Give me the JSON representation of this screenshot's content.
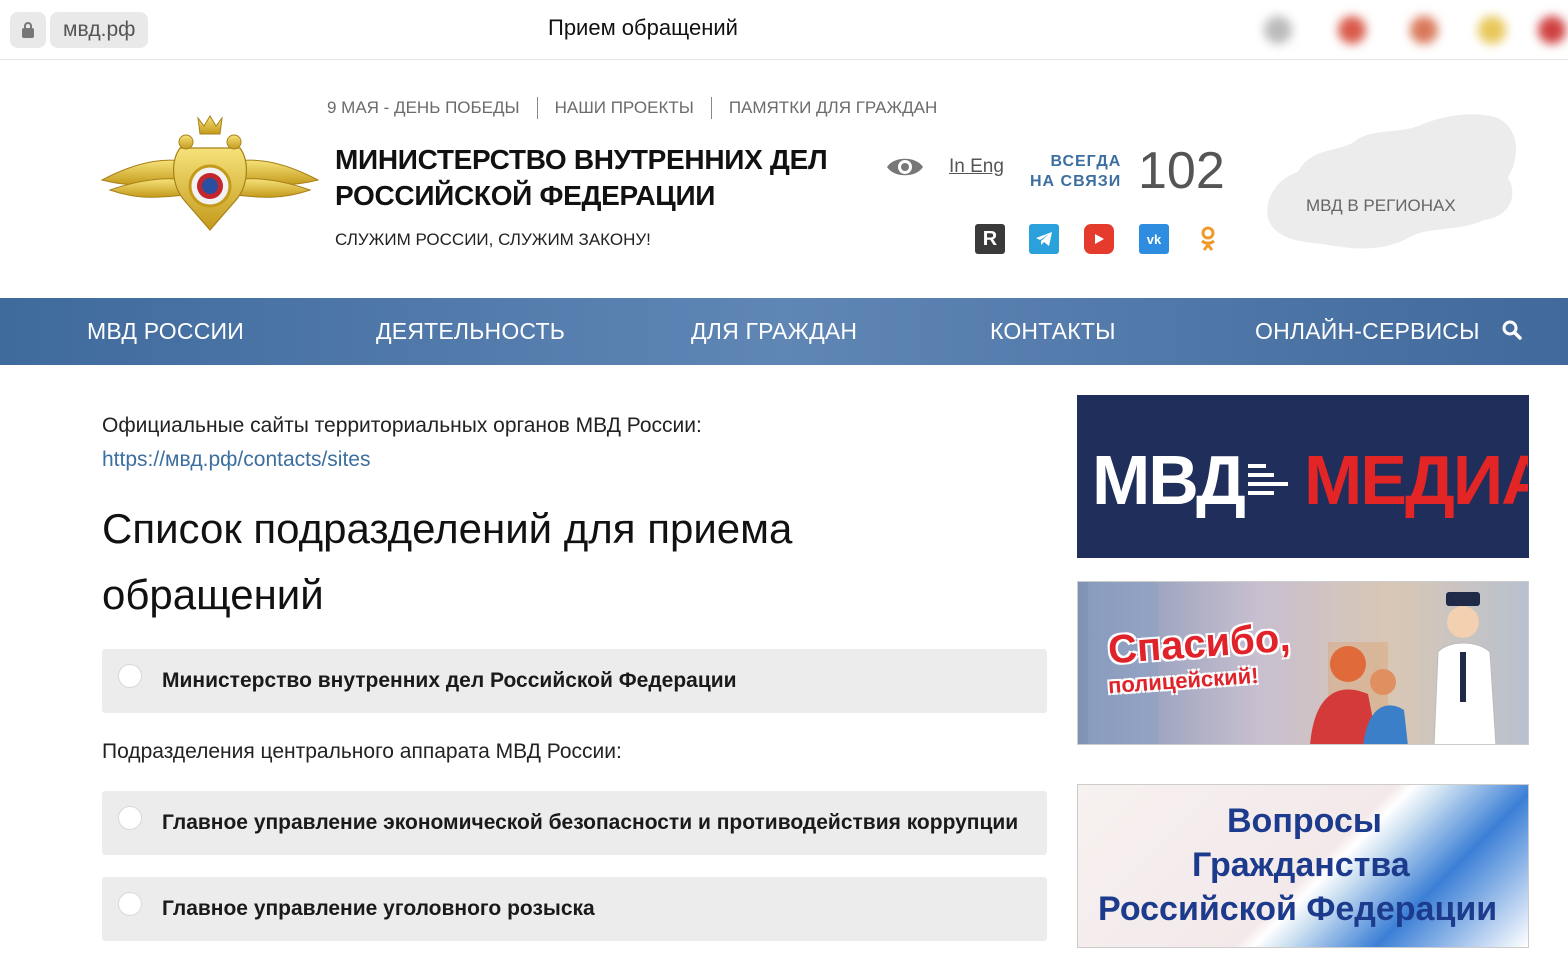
{
  "browser": {
    "url": "мвд.рф",
    "page_title": "Прием обращений"
  },
  "header": {
    "top_links": [
      "9 МАЯ - ДЕНЬ ПОБЕДЫ",
      "НАШИ ПРОЕКТЫ",
      "ПАМЯТКИ ДЛЯ ГРАЖДАН"
    ],
    "ministry_line1": "МИНИСТЕРСТВО ВНУТРЕННИХ ДЕЛ",
    "ministry_line2": "РОССИЙСКОЙ ФЕДЕРАЦИИ",
    "motto": "СЛУЖИМ РОССИИ, СЛУЖИМ ЗАКОНУ!",
    "lang_link": "In Eng",
    "always_line1": "ВСЕГДА",
    "always_line2": "НА СВЯЗИ",
    "hotline_number": "102",
    "regions_label": "МВД В РЕГИОНАХ",
    "social_icons": [
      "rutube-icon",
      "telegram-icon",
      "youtube-icon",
      "vk-icon",
      "odnoklassniki-icon"
    ]
  },
  "nav": {
    "items": [
      "МВД РОССИИ",
      "ДЕЯТЕЛЬНОСТЬ",
      "ДЛЯ ГРАЖДАН",
      "КОНТАКТЫ",
      "ОНЛАЙН-СЕРВИСЫ"
    ]
  },
  "main": {
    "intro_text": "Официальные сайты территориальных органов МВД России:",
    "intro_link": "https://мвд.рф/contacts/sites",
    "list_title_line1": "Список подразделений для приема",
    "list_title_line2": "обращений",
    "option_ministry": "Министерство внутренних дел Российской Федерации",
    "central_subhead": "Подразделения центрального аппарата МВД России:",
    "option_economic": "Главное управление экономической безопасности и противодействия коррупции",
    "option_criminal": "Главное управление уголовного розыска"
  },
  "banners": {
    "media_left": "МВД",
    "media_right": "МЕДИА",
    "thanks_line1": "Спасибо,",
    "thanks_line2": "полицейский!",
    "citizen_line1": "Вопросы",
    "citizen_line2": "Гражданства",
    "citizen_line3": "Российской Федерации"
  },
  "colors": {
    "nav_blue": "#4e77a9",
    "link_blue": "#3c6f9f",
    "media_navy": "#1f2e5a",
    "media_red": "#e32526",
    "option_bg": "#ececec"
  }
}
